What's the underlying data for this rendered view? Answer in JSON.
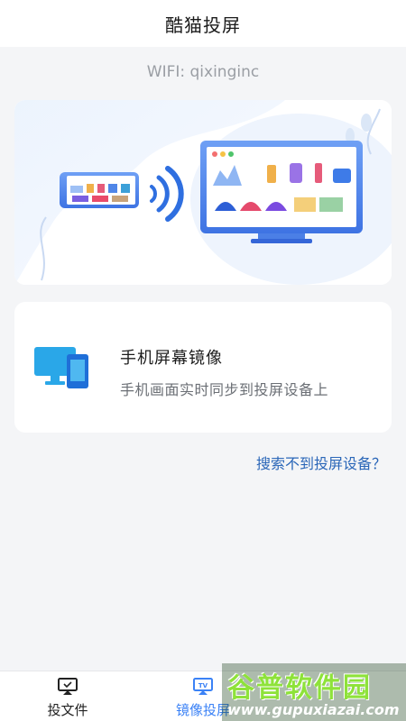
{
  "header": {
    "title": "酷猫投屏"
  },
  "wifi": {
    "text": "WIFI: qixinginc"
  },
  "mirror_card": {
    "title": "手机屏幕镜像",
    "subtitle": "手机画面实时同步到投屏设备上"
  },
  "help_link": "搜索不到投屏设备？",
  "tabs": [
    {
      "label": "投文件",
      "icon": "cast-file-icon",
      "active": false
    },
    {
      "label": "镜像投屏",
      "icon": "tv-mirror-icon",
      "active": true
    }
  ],
  "watermark": {
    "big": "谷普软件园",
    "small": "www.gupuxiazai.com"
  },
  "colors": {
    "accent": "#3b82f6",
    "link": "#2a66b8",
    "background": "#f4f5f7"
  }
}
